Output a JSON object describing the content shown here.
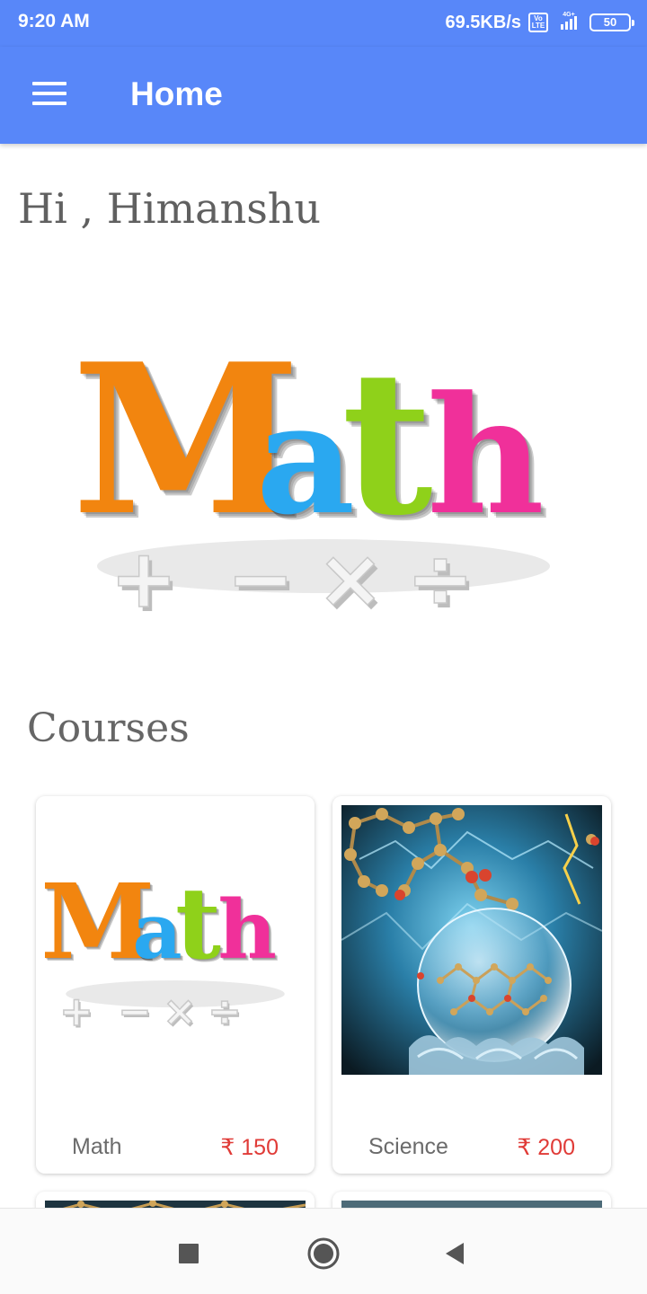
{
  "status_bar": {
    "time": "9:20 AM",
    "network_speed": "69.5KB/s",
    "volte_label": "Vo LTE",
    "signal_label": "4G+",
    "battery": "50"
  },
  "app_bar": {
    "title": "Home",
    "menu_icon": "hamburger-menu-icon"
  },
  "greeting": "Hi , Himanshu",
  "hero": {
    "logo_text": "Math",
    "logo_letters": [
      "M",
      "a",
      "t",
      "h"
    ],
    "logo_colors": [
      "#f2850f",
      "#2aa8f0",
      "#8fd11a",
      "#f0309a"
    ],
    "operators": [
      "+",
      "−",
      "×",
      "÷"
    ]
  },
  "courses": {
    "heading": "Courses",
    "items": [
      {
        "name": "Math",
        "price": "₹ 150"
      },
      {
        "name": "Science",
        "price": "₹ 200"
      }
    ]
  },
  "nav_bar": {
    "icons": [
      "recent-apps-icon",
      "home-icon",
      "back-icon"
    ]
  },
  "colors": {
    "primary": "#5887f9",
    "price": "#e03b37",
    "text_muted": "#6b6b6b"
  }
}
